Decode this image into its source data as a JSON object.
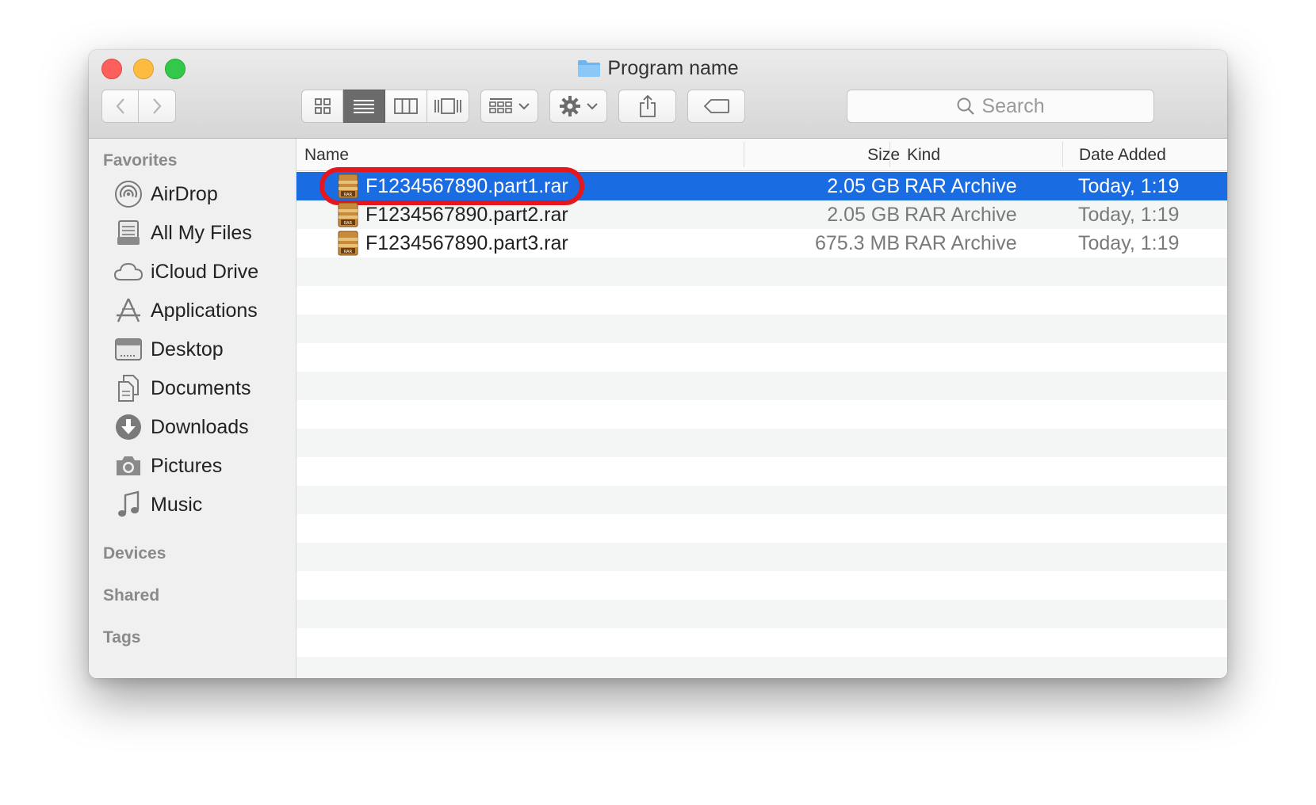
{
  "window": {
    "title": "Program name"
  },
  "toolbar": {
    "back_icon": "chevron-left-icon",
    "forward_icon": "chevron-right-icon",
    "view_modes": [
      "icon-view-icon",
      "list-view-icon",
      "column-view-icon",
      "cover-flow-icon"
    ],
    "active_view": "list",
    "search_placeholder": "Search"
  },
  "sidebar": {
    "favorites_heading": "Favorites",
    "items": [
      {
        "label": "AirDrop",
        "icon": "airdrop-icon"
      },
      {
        "label": "All My Files",
        "icon": "all-files-icon"
      },
      {
        "label": "iCloud Drive",
        "icon": "cloud-icon"
      },
      {
        "label": "Applications",
        "icon": "applications-icon"
      },
      {
        "label": "Desktop",
        "icon": "desktop-icon"
      },
      {
        "label": "Documents",
        "icon": "documents-icon"
      },
      {
        "label": "Downloads",
        "icon": "downloads-icon"
      },
      {
        "label": "Pictures",
        "icon": "camera-icon"
      },
      {
        "label": "Music",
        "icon": "music-note-icon"
      }
    ],
    "devices_heading": "Devices",
    "shared_heading": "Shared",
    "tags_heading": "Tags"
  },
  "list": {
    "columns": {
      "name": "Name",
      "size": "Size",
      "kind": "Kind",
      "date": "Date Added"
    },
    "rows": [
      {
        "name": "F1234567890.part1.rar",
        "size": "2.05 GB",
        "kind": "RAR Archive",
        "date": "Today, 1:19",
        "selected": true
      },
      {
        "name": "F1234567890.part2.rar",
        "size": "2.05 GB",
        "kind": "RAR Archive",
        "date": "Today, 1:19",
        "selected": false
      },
      {
        "name": "F1234567890.part3.rar",
        "size": "675.3 MB",
        "kind": "RAR Archive",
        "date": "Today, 1:19",
        "selected": false
      }
    ]
  },
  "colors": {
    "selection": "#1a6ce2",
    "highlight_ring": "#e3171d"
  }
}
